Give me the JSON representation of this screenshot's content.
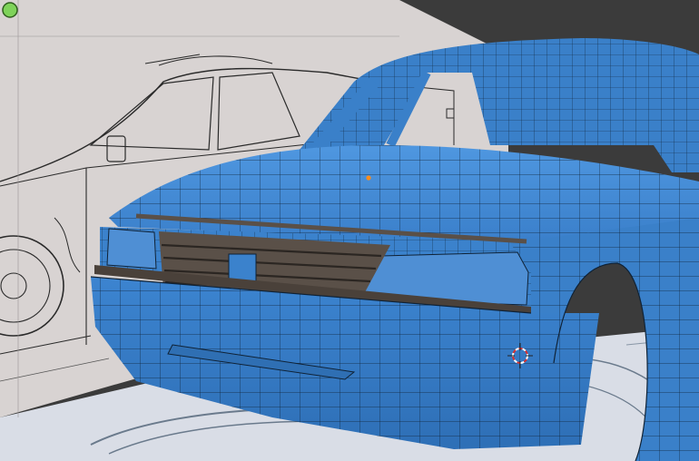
{
  "app": {
    "name": ""
  },
  "viewport": {
    "mode": "edit-mode-mesh",
    "colors": {
      "background": "#3b3b3b",
      "reference_sheet": "#d8d3d2",
      "floor_reference": "#d9dde6",
      "mesh_face": "#3f86d1",
      "mesh_face_dark": "#2f6fb3",
      "mesh_wire": "#102030",
      "grille": "#5a5048",
      "selected_vertex": "#ff8c1a",
      "cursor_ring_red": "#d63030",
      "gizmo_green": "#7fd35a"
    },
    "objects": [
      "reference-image-side",
      "reference-image-top",
      "car-body-mesh",
      "3d-cursor",
      "origin-point"
    ]
  }
}
